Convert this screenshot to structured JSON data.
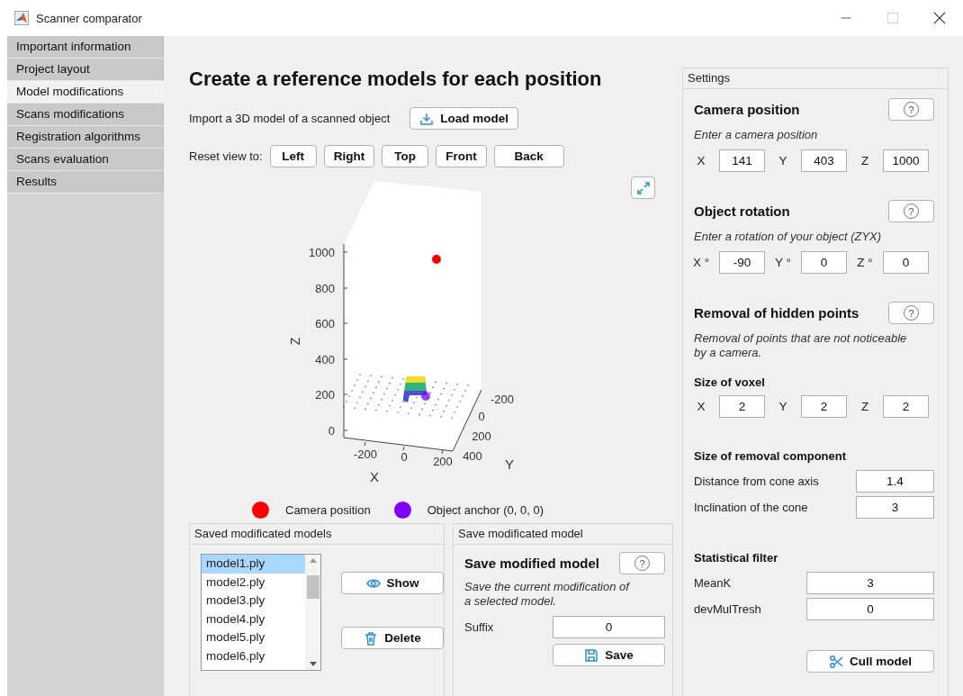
{
  "window": {
    "title": "Scanner comparator"
  },
  "sidebar": {
    "items": [
      {
        "label": "Important information",
        "selected": false
      },
      {
        "label": "Project layout",
        "selected": false
      },
      {
        "label": "Model modifications",
        "selected": true
      },
      {
        "label": "Scans modifications",
        "selected": false
      },
      {
        "label": "Registration algorithms",
        "selected": false
      },
      {
        "label": "Scans evaluation",
        "selected": false
      },
      {
        "label": "Results",
        "selected": false
      }
    ]
  },
  "main": {
    "title": "Create a reference models for each position",
    "import_label": "Import a 3D model of a scanned object",
    "load_button": "Load model",
    "reset_label": "Reset view to:",
    "view_buttons": [
      "Left",
      "Right",
      "Top",
      "Front",
      "Back"
    ],
    "plot": {
      "zlabel": "Z",
      "xlabel": "X",
      "ylabel": "Y",
      "zticks": [
        "1000",
        "800",
        "600",
        "400",
        "200",
        "0"
      ],
      "xticks": [
        "-200",
        "0",
        "200"
      ],
      "yticks": [
        "-200",
        "0",
        "200",
        "400"
      ],
      "legend": [
        {
          "label": "Camera position",
          "color": "#ff0000"
        },
        {
          "label": "Object anchor (0, 0, 0)",
          "color": "#7f00ff"
        }
      ]
    }
  },
  "saved_models": {
    "title": "Saved modificated models",
    "items": [
      {
        "label": "model1.ply",
        "selected": true
      },
      {
        "label": "model2.ply",
        "selected": false
      },
      {
        "label": "model3.ply",
        "selected": false
      },
      {
        "label": "model4.ply",
        "selected": false
      },
      {
        "label": "model5.ply",
        "selected": false
      },
      {
        "label": "model6.ply",
        "selected": false
      }
    ],
    "show_button": "Show",
    "delete_button": "Delete"
  },
  "save_model": {
    "title": "Save modificated model",
    "heading": "Save modified model",
    "help": "?",
    "description": "Save the current modification of a selected model.",
    "suffix_label": "Suffix",
    "suffix_value": "0",
    "save_button": "Save"
  },
  "settings": {
    "title": "Settings",
    "camera": {
      "heading": "Camera position",
      "help": "?",
      "hint": "Enter a camera position",
      "fields": [
        {
          "label": "X",
          "value": "141"
        },
        {
          "label": "Y",
          "value": "403"
        },
        {
          "label": "Z",
          "value": "1000"
        }
      ]
    },
    "rotation": {
      "heading": "Object rotation",
      "help": "?",
      "hint": "Enter a rotation of your object (ZYX)",
      "fields": [
        {
          "label": "X °",
          "value": "-90"
        },
        {
          "label": "Y °",
          "value": "0"
        },
        {
          "label": "Z °",
          "value": "0"
        }
      ]
    },
    "hidden": {
      "heading": "Removal of hidden points",
      "help": "?",
      "hint": "Removal of points that are not noticeable by a camera.",
      "voxel_heading": "Size of voxel",
      "voxel_fields": [
        {
          "label": "X",
          "value": "2"
        },
        {
          "label": "Y",
          "value": "2"
        },
        {
          "label": "Z",
          "value": "2"
        }
      ],
      "component_heading": "Size of removal component",
      "component_fields": [
        {
          "label": "Distance from cone axis",
          "value": "1.4"
        },
        {
          "label": "Inclination of the cone",
          "value": "3"
        }
      ]
    },
    "filter": {
      "heading": "Statistical filter",
      "fields": [
        {
          "label": "MeanK",
          "value": "3"
        },
        {
          "label": "devMulTresh",
          "value": "0"
        }
      ]
    },
    "cull_button": "Cull model"
  }
}
